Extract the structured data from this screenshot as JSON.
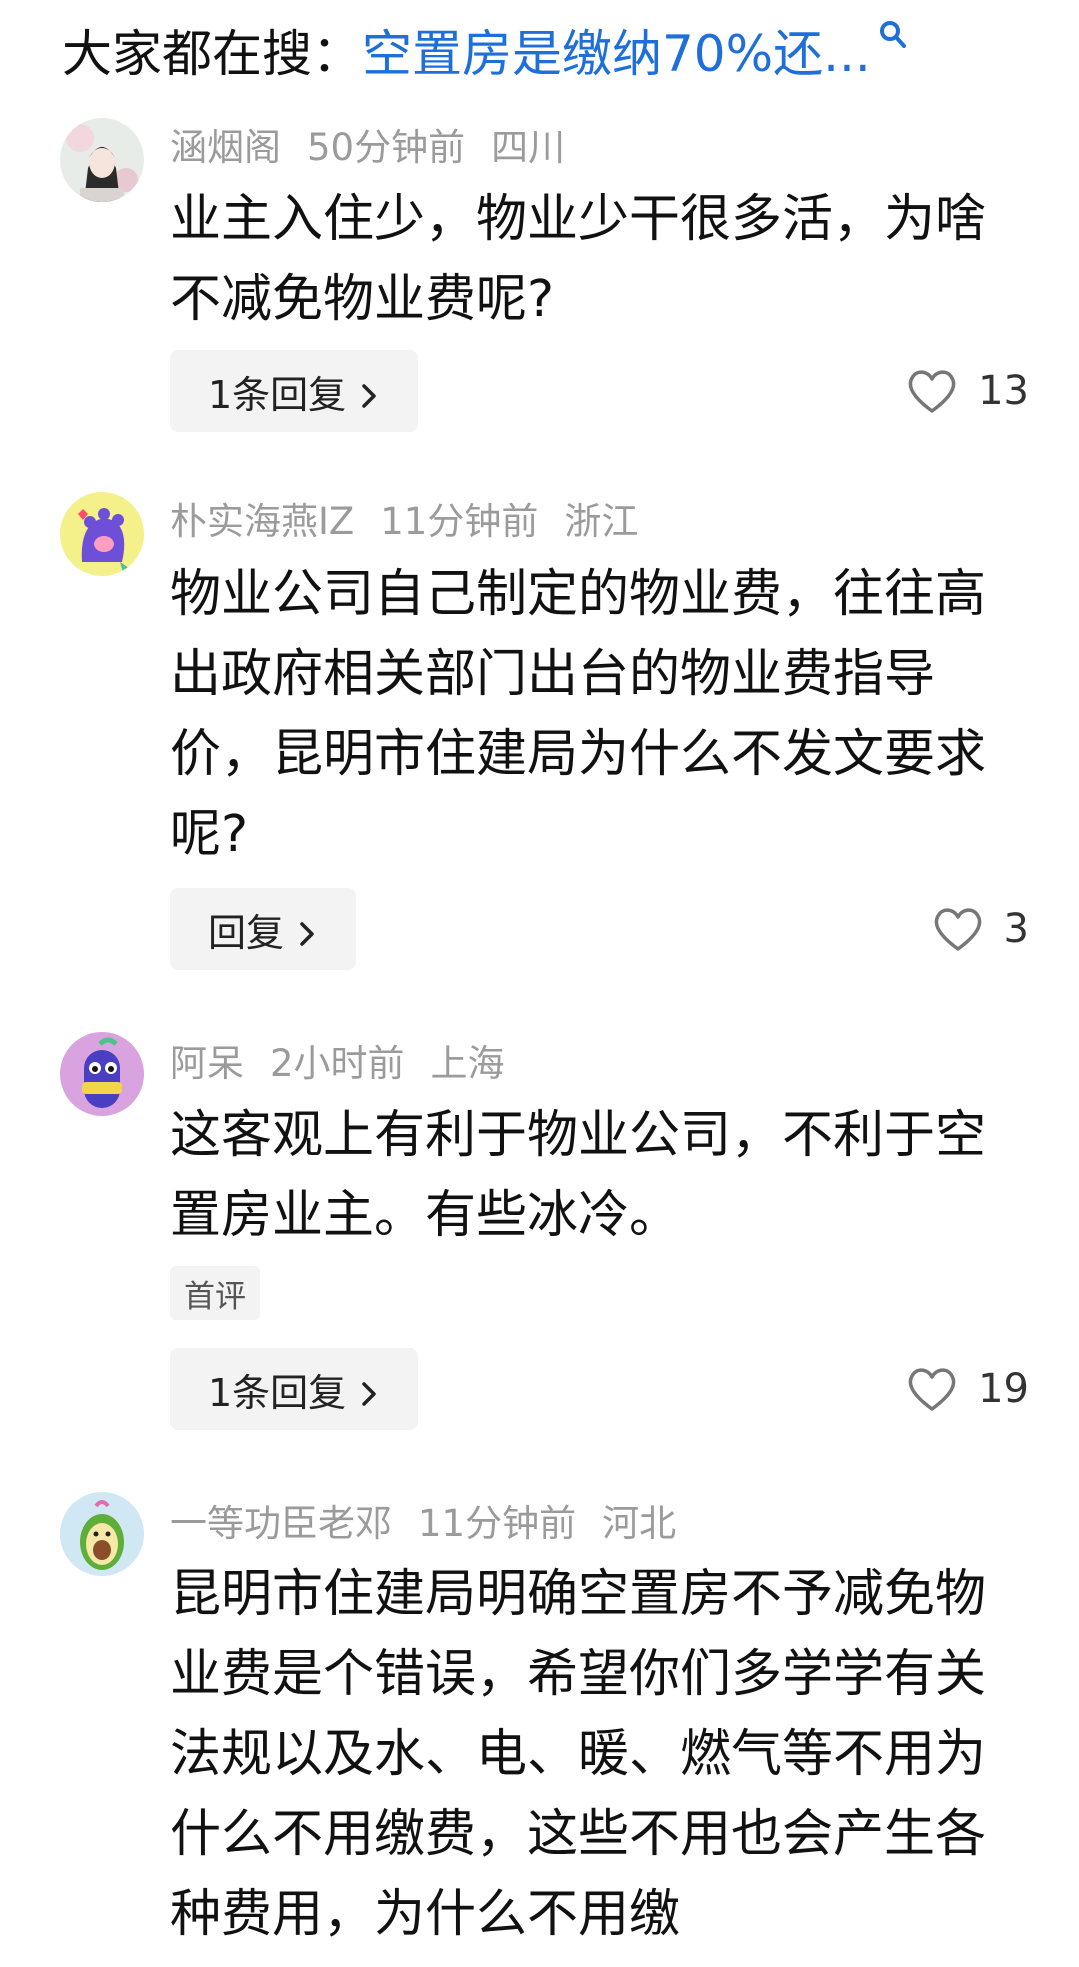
{
  "search": {
    "prefix": "大家都在搜：",
    "query": "空置房是缴纳70%还..."
  },
  "comments": [
    {
      "user": "涵烟阁",
      "time": "50分钟前",
      "location": "四川",
      "text": "业主入住少，物业少干很多活，为啥不减免物业费呢?",
      "reply_label": "1条回复",
      "likes": "13"
    },
    {
      "user": "朴实海燕IZ",
      "time": "11分钟前",
      "location": "浙江",
      "text": "物业公司自己制定的物业费，往往高出政府相关部门出台的物业费指导价，昆明市住建局为什么不发文要求呢?",
      "reply_label": "回复",
      "likes": "3"
    },
    {
      "user": "阿呆",
      "time": "2小时前",
      "location": "上海",
      "text": "这客观上有利于物业公司，不利于空置房业主。有些冰冷。",
      "badge": "首评",
      "reply_label": "1条回复",
      "likes": "19"
    },
    {
      "user": "一等功臣老邓",
      "time": "11分钟前",
      "location": "河北",
      "text": "昆明市住建局明确空置房不予减免物业费是个错误，希望你们多学学有关法规以及水、电、暖、燃气等不用为什么不用缴费，这些不用也会产生各种费用，为什么不用缴"
    }
  ],
  "colors": {
    "accent": "#1e6fd9",
    "meta_gray": "#9b9b9b",
    "button_bg": "#f3f3f3"
  },
  "icons": {
    "search": "search-icon",
    "like": "heart-outline-icon",
    "chevron": "chevron-right-icon"
  }
}
